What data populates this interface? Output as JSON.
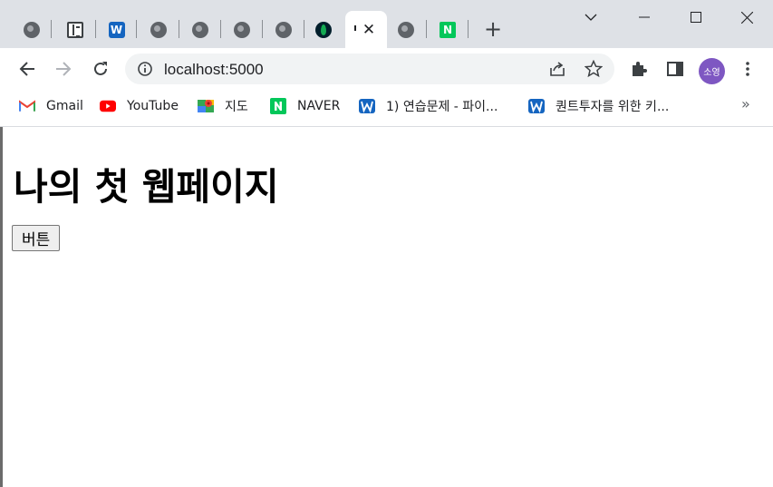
{
  "browser": {
    "tabs": [
      {
        "icon": "globe-icon"
      },
      {
        "icon": "book-icon"
      },
      {
        "icon": "wikidocs-icon",
        "glyph": "W"
      },
      {
        "icon": "globe-icon"
      },
      {
        "icon": "globe-icon"
      },
      {
        "icon": "globe-icon"
      },
      {
        "icon": "globe-icon"
      },
      {
        "icon": "mongodb-icon"
      },
      {
        "icon": "close-icon",
        "glyph": "✕",
        "active": true
      },
      {
        "icon": "globe-icon"
      },
      {
        "icon": "naver-icon",
        "glyph": "N"
      }
    ],
    "new_tab_glyph": "+",
    "window_controls": {
      "minimize": "—",
      "maximize": "☐",
      "close": "✕"
    }
  },
  "toolbar": {
    "url": "localhost:5000",
    "profile_initials": "소영"
  },
  "bookmarks": {
    "items": [
      {
        "label": "Gmail",
        "icon": "gmail-icon"
      },
      {
        "label": "YouTube",
        "icon": "youtube-icon"
      },
      {
        "label": "지도",
        "icon": "maps-icon"
      },
      {
        "label": "NAVER",
        "icon": "naver-icon"
      },
      {
        "label": "1) 연습문제 - 파이...",
        "icon": "wikidocs-icon"
      },
      {
        "label": "퀀트투자를 위한 키...",
        "icon": "wikidocs-icon"
      }
    ],
    "more_glyph": "»"
  },
  "page": {
    "heading": "나의 첫 웹페이지",
    "button_label": "버튼"
  },
  "colors": {
    "tabstrip": "#dee1e6",
    "avatar": "#7e57c2",
    "naver": "#03c75a",
    "wikidocs": "#1565c0"
  }
}
